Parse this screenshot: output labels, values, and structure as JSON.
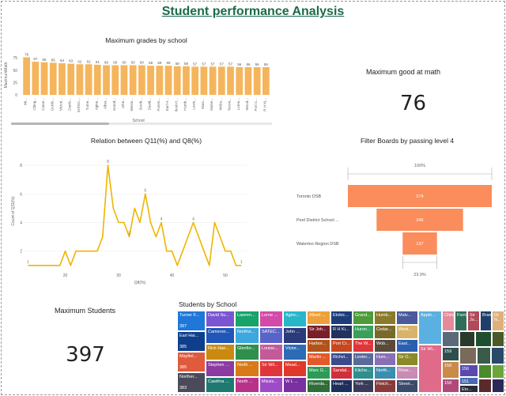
{
  "report": {
    "title": "Student performance Analysis"
  },
  "bar_chart": {
    "title": "Maximum grades by school",
    "xlabel": "School",
    "ylabel": "MaximumMath",
    "color": "#f5b55c"
  },
  "line_chart": {
    "title": "Relation between Q11(%) and Q8(%)",
    "xlabel": "Q8(%)",
    "ylabel": "Count of Q11(%)",
    "color": "#f0b400"
  },
  "funnel": {
    "title": "Filter Boards by passing level 4",
    "top_label": "100%",
    "bottom_label": "23.9%",
    "color": "#fb8c5c"
  },
  "card_math": {
    "title": "Maximum good at math",
    "value": "76"
  },
  "card_students": {
    "title": "Maximum Students",
    "value": "397"
  },
  "treemap": {
    "title": "Students by School"
  },
  "chart_data": [
    {
      "type": "bar",
      "title": "Maximum grades by school",
      "xlabel": "School",
      "ylabel": "MaximumMath",
      "ylim": [
        0,
        80
      ],
      "yticks": [
        0,
        25,
        50,
        75
      ],
      "categories": [
        "Wi...",
        "Ching...",
        "Came...",
        "Gordo...",
        "Victori...",
        "Danfo...",
        "SATEC...",
        "Turne...",
        "Agine...",
        "Alber...",
        "Grand...",
        "John...",
        "Weste...",
        "South...",
        "David...",
        "Forest...",
        "Earl H...",
        "Ikod-H...",
        "Humb...",
        "Leste...",
        "Marc...",
        "Malve...",
        "Wobu...",
        "Toront...",
        "Lorne...",
        "Wood...",
        "Port C...",
        "R H Ki..."
      ],
      "values": [
        76,
        67,
        66,
        65,
        64,
        63,
        62,
        62,
        61,
        60,
        60,
        60,
        60,
        60,
        59,
        59,
        59,
        58,
        58,
        57,
        57,
        57,
        57,
        57,
        56,
        56,
        56,
        56
      ]
    },
    {
      "type": "line",
      "title": "Relation between Q11(%) and Q8(%)",
      "xlabel": "Q8(%)",
      "ylabel": "Count of Q11(%)",
      "xticks": [
        20,
        30,
        40,
        50
      ],
      "yticks": [
        2,
        4,
        6,
        8
      ],
      "xlim": [
        14,
        54
      ],
      "ylim": [
        0.6,
        9
      ],
      "x": [
        13,
        16,
        19,
        20,
        21,
        22,
        24,
        26,
        27,
        28,
        29,
        30,
        31,
        32,
        33,
        34,
        35,
        36,
        37,
        38,
        39,
        40,
        41,
        42,
        43,
        44,
        45,
        46,
        47,
        48,
        49,
        50,
        51,
        52,
        53
      ],
      "y": [
        1,
        1,
        1,
        2,
        1,
        2,
        2,
        2,
        3,
        8,
        5,
        4,
        4,
        3,
        5,
        4,
        6,
        4,
        3,
        4,
        2,
        2,
        1,
        2,
        3,
        4,
        3,
        2,
        1,
        4,
        3,
        2,
        2,
        1,
        1
      ],
      "data_labels": [
        {
          "x": 13,
          "y": 1,
          "text": "1"
        },
        {
          "x": 28,
          "y": 8,
          "text": "8"
        },
        {
          "x": 32,
          "y": 3,
          "text": "3"
        },
        {
          "x": 35,
          "y": 6,
          "text": "6"
        },
        {
          "x": 38,
          "y": 4,
          "text": "4"
        },
        {
          "x": 44,
          "y": 4,
          "text": "4"
        },
        {
          "x": 53,
          "y": 1,
          "text": "1"
        }
      ]
    },
    {
      "type": "bar",
      "subtype": "funnel",
      "title": "Filter Boards by passing level 4",
      "categories": [
        "Toronto DSB",
        "Peel District School ...",
        "Waterloo Region DSB"
      ],
      "values": [
        574,
        345,
        137
      ],
      "top_label": "100%",
      "bottom_label": "23.9%"
    },
    {
      "type": "table",
      "subtype": "treemap",
      "title": "Students by School",
      "tiles": [
        {
          "label": "Turner F...",
          "value": "397",
          "color": "#1f77d9"
        },
        {
          "label": "Earl Hai...",
          "value": "385",
          "color": "#0f3f8c"
        },
        {
          "label": "Mayfiel...",
          "value": "385",
          "color": "#e05a3c"
        },
        {
          "label": "Norther...",
          "value": "383",
          "color": "#4a4a5a"
        },
        {
          "label": "David Su...",
          "value": "",
          "color": "#7a55d1"
        },
        {
          "label": "Cameron...",
          "value": "",
          "color": "#1f56b8"
        },
        {
          "label": "Rick Han...",
          "value": "",
          "color": "#c98a0f"
        },
        {
          "label": "Stephen ...",
          "value": "",
          "color": "#8c3ba1"
        },
        {
          "label": "Cawthra ...",
          "value": "",
          "color": "#1e7a70"
        },
        {
          "label": "Lawren...",
          "value": "",
          "color": "#17a36a"
        },
        {
          "label": "Northvi...",
          "value": "",
          "color": "#3da7df"
        },
        {
          "label": "Glenfor...",
          "value": "",
          "color": "#2f8f4d"
        },
        {
          "label": "North ...",
          "value": "",
          "color": "#d77a17"
        },
        {
          "label": "North ...",
          "value": "",
          "color": "#b8328a"
        },
        {
          "label": "Lorne ...",
          "value": "",
          "color": "#d44aa8"
        },
        {
          "label": "SATEC...",
          "value": "",
          "color": "#5a63c9"
        },
        {
          "label": "Louise...",
          "value": "",
          "color": "#c45a9a"
        },
        {
          "label": "Sir Wil...",
          "value": "",
          "color": "#e0353a"
        },
        {
          "label": "Missis...",
          "value": "",
          "color": "#9e4bc7"
        },
        {
          "label": "Aginc...",
          "value": "",
          "color": "#29b6c9"
        },
        {
          "label": "John ...",
          "value": "",
          "color": "#2a3a7a"
        },
        {
          "label": "Victor...",
          "value": "",
          "color": "#2d6bb5"
        },
        {
          "label": "Mead...",
          "value": "",
          "color": "#e0392b"
        },
        {
          "label": "W L ...",
          "value": "",
          "color": "#7a2fa0"
        },
        {
          "label": "Albert ...",
          "value": "",
          "color": "#ef9f3a"
        },
        {
          "label": "Sir Joh...",
          "value": "",
          "color": "#7a1f2a"
        },
        {
          "label": "Harbor...",
          "value": "",
          "color": "#b3531a"
        },
        {
          "label": "Martin ...",
          "value": "",
          "color": "#e35a2a"
        },
        {
          "label": "Marc G...",
          "value": "",
          "color": "#2e9b55"
        },
        {
          "label": "Riverda...",
          "value": "",
          "color": "#2f6e3a"
        },
        {
          "label": "Etobic...",
          "value": "",
          "color": "#1c3d7a"
        },
        {
          "label": "R H Ki...",
          "value": "",
          "color": "#22315e"
        },
        {
          "label": "Port Cr...",
          "value": "",
          "color": "#c7471f"
        },
        {
          "label": "Richvi...",
          "value": "",
          "color": "#3c4a8c"
        },
        {
          "label": "Sandal...",
          "value": "",
          "color": "#d0303a"
        },
        {
          "label": "Heart ...",
          "value": "",
          "color": "#1f2f5c"
        },
        {
          "label": "Grand...",
          "value": "",
          "color": "#4d9b3a"
        },
        {
          "label": "Huron...",
          "value": "",
          "color": "#3a9f5a"
        },
        {
          "label": "The W...",
          "value": "",
          "color": "#e0353a"
        },
        {
          "label": "Lester...",
          "value": "",
          "color": "#5a6a9a"
        },
        {
          "label": "Kitche...",
          "value": "",
          "color": "#2f8f8f"
        },
        {
          "label": "York ...",
          "value": "",
          "color": "#3a3a5a"
        },
        {
          "label": "Humb...",
          "value": "",
          "color": "#8a7a2a"
        },
        {
          "label": "Cedar...",
          "value": "",
          "color": "#7a6a2a"
        },
        {
          "label": "Wob...",
          "value": "",
          "color": "#5a4a3a"
        },
        {
          "label": "Hum...",
          "value": "",
          "color": "#8a6fb5"
        },
        {
          "label": "North...",
          "value": "",
          "color": "#3a8fb0"
        },
        {
          "label": "Fletch...",
          "value": "",
          "color": "#8a3a3a"
        },
        {
          "label": "Malv...",
          "value": "",
          "color": "#4a5a9a"
        },
        {
          "label": "West...",
          "value": "",
          "color": "#d9b36a"
        },
        {
          "label": "East...",
          "value": "",
          "color": "#2a5fb0"
        },
        {
          "label": "Sir O...",
          "value": "",
          "color": "#8a8a2a"
        },
        {
          "label": "Rose...",
          "value": "",
          "color": "#c98ab5"
        },
        {
          "label": "Street...",
          "value": "",
          "color": "#3a4a6a"
        },
        {
          "label": "Apple...",
          "value": "",
          "color": "#5ab0e0"
        },
        {
          "label": "Sir Wi...",
          "value": "",
          "color": "#e06a8a"
        },
        {
          "label": "Ching...",
          "value": "",
          "color": "#e58a9a"
        },
        {
          "label": "Forris...",
          "value": "",
          "color": "#2f6f5a"
        },
        {
          "label": "Sir Jo...",
          "value": "",
          "color": "#b04a5a"
        },
        {
          "label": "Bram...",
          "value": "",
          "color": "#1f3f6a"
        },
        {
          "label": "Dr N...",
          "value": "",
          "color": "#e0b07a"
        },
        {
          "label": "159",
          "value": "",
          "color": "#2f4f4f"
        },
        {
          "label": "158",
          "value": "",
          "color": "#c98a4a"
        },
        {
          "label": "158",
          "value": "",
          "color": "#b04a7a"
        },
        {
          "label": "156",
          "value": "",
          "color": "#5a4ab0"
        },
        {
          "label": "151",
          "value": "",
          "color": "#4a6ab0"
        },
        {
          "label": "Eto...",
          "value": "",
          "color": "#2a2a3a"
        },
        {
          "label": "Silv...",
          "value": "",
          "color": "#6a7a3a"
        },
        {
          "label": "Sou...",
          "value": "",
          "color": "#2a3a3a"
        },
        {
          "label": "Danf...",
          "value": "",
          "color": "#3a3a3a"
        },
        {
          "label": "Linc...",
          "value": "",
          "color": "#2a3ab0"
        },
        {
          "label": "Birch...",
          "value": "",
          "color": "#3a2a2a"
        }
      ]
    }
  ]
}
